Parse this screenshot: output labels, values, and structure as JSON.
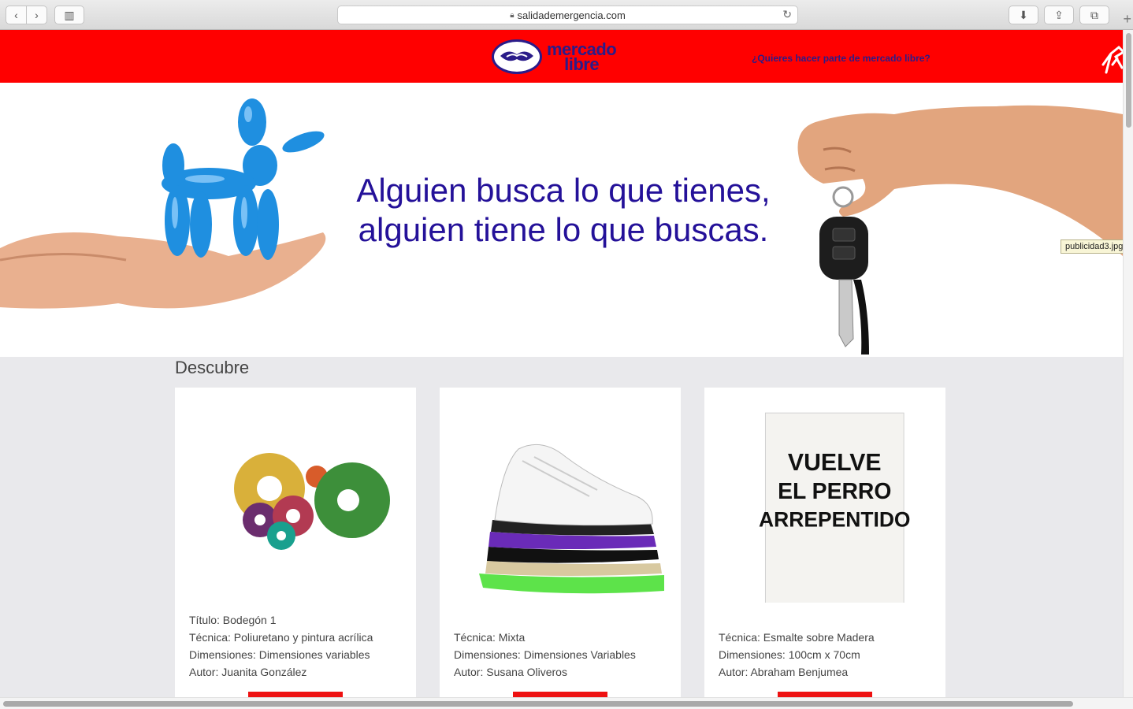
{
  "browser": {
    "url": "salidademergencia.com"
  },
  "header": {
    "logo_line1": "mercado",
    "logo_line2": "libre",
    "join_link": "¿Quieres hacer parte de mercado libre?",
    "brand_color": "#ff0000"
  },
  "hero": {
    "headline": "Alguien busca lo que tienes, alguien tiene lo que buscas.",
    "tooltip": "publicidad3.jpg"
  },
  "discover": {
    "title": "Descubre",
    "cards": [
      {
        "lines": [
          "Título: Bodegón 1",
          "Técnica: Poliuretano y pintura acrílica",
          "Dimensiones: Dimensiones variables",
          "Autor: Juanita González"
        ]
      },
      {
        "lines": [
          "Técnica: Mixta",
          "Dimensiones: Dimensiones Variables",
          "Autor: Susana Oliveros"
        ]
      },
      {
        "lines": [
          "Técnica: Esmalte sobre Madera",
          "Dimensiones: 100cm x 70cm",
          "Autor: Abraham Benjumea"
        ]
      }
    ],
    "poster_text": [
      "VUELVE",
      "EL PERRO",
      "ARREPENTIDO"
    ]
  }
}
